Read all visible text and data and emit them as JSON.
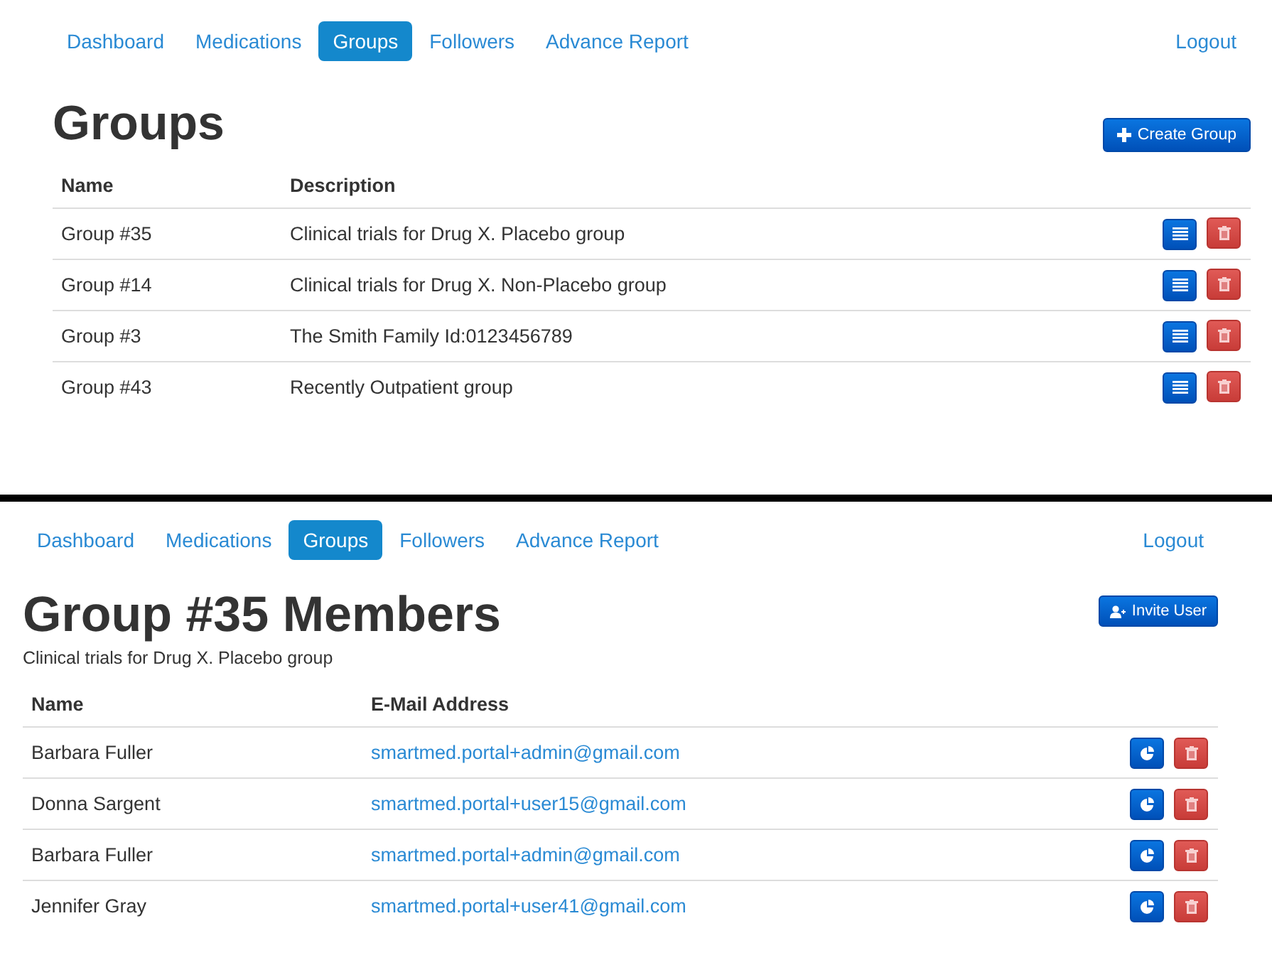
{
  "groups_page": {
    "nav": {
      "items": [
        {
          "label": "Dashboard",
          "selected": false
        },
        {
          "label": "Medications",
          "selected": false
        },
        {
          "label": "Groups",
          "selected": true
        },
        {
          "label": "Followers",
          "selected": false
        },
        {
          "label": "Advance Report",
          "selected": false
        }
      ],
      "logout": "Logout"
    },
    "title": "Groups",
    "action": "Create Group",
    "table": {
      "columns": [
        "Name",
        "Description"
      ],
      "rows": [
        {
          "name": "Group #35",
          "description": "Clinical trials for Drug X. Placebo group"
        },
        {
          "name": "Group #14",
          "description": "Clinical trials for Drug X. Non-Placebo group"
        },
        {
          "name": "Group #3",
          "description": "The Smith Family Id:0123456789"
        },
        {
          "name": "Group #43",
          "description": "Recently Outpatient group"
        }
      ]
    }
  },
  "members_page": {
    "nav": {
      "items": [
        {
          "label": "Dashboard",
          "selected": false
        },
        {
          "label": "Medications",
          "selected": false
        },
        {
          "label": "Groups",
          "selected": true
        },
        {
          "label": "Followers",
          "selected": false
        },
        {
          "label": "Advance Report",
          "selected": false
        }
      ],
      "logout": "Logout"
    },
    "title": "Group #35 Members",
    "subtitle": "Clinical trials for Drug X. Placebo group",
    "action": "Invite User",
    "table": {
      "columns": [
        "Name",
        "E-Mail Address"
      ],
      "rows": [
        {
          "name": "Barbara Fuller",
          "email": "smartmed.portal+admin@gmail.com"
        },
        {
          "name": "Donna Sargent",
          "email": "smartmed.portal+user15@gmail.com"
        },
        {
          "name": "Barbara Fuller",
          "email": "smartmed.portal+admin@gmail.com"
        },
        {
          "name": "Jennifer Gray",
          "email": "smartmed.portal+user41@gmail.com"
        }
      ]
    }
  }
}
